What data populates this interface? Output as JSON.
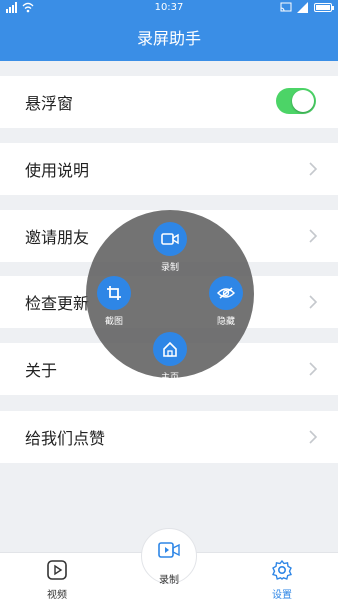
{
  "status_bar": {
    "time": "10:37"
  },
  "title": "录屏助手",
  "settings": {
    "floating_window": "悬浮窗",
    "floating_window_enabled": true,
    "items": [
      "使用说明",
      "邀请朋友",
      "检查更新",
      "关于",
      "给我们点赞"
    ]
  },
  "floating_menu": {
    "record": "录制",
    "screenshot": "截图",
    "hide": "隐藏",
    "home": "主页"
  },
  "tabs": {
    "video": "视频",
    "record": "录制",
    "settings": "设置"
  },
  "colors": {
    "accent": "#3a8ee6",
    "toggle_on": "#4cd467",
    "active_tab": "#2e86e6"
  }
}
